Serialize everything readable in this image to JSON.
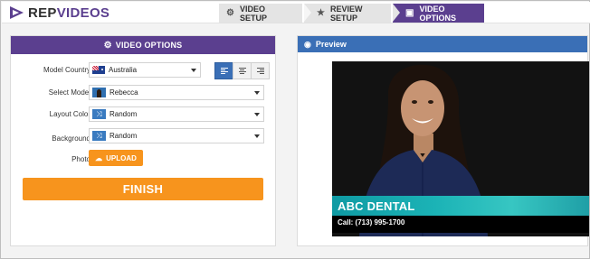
{
  "brand": {
    "name_part1": "REP",
    "name_part2": "VIDEOS",
    "accent": "#5b3f8f"
  },
  "steps": [
    {
      "label": "VIDEO SETUP",
      "icon": "gears-icon",
      "active": false
    },
    {
      "label": "REVIEW SETUP",
      "icon": "star-icon",
      "active": false
    },
    {
      "label": "VIDEO OPTIONS",
      "icon": "film-icon",
      "active": true
    }
  ],
  "options_panel": {
    "title": "VIDEO OPTIONS",
    "fields": {
      "model_country": {
        "label": "Model Country",
        "value": "Australia"
      },
      "select_model": {
        "label": "Select Model",
        "value": "Rebecca"
      },
      "layout_color": {
        "label": "Layout Color",
        "value": "Random"
      },
      "background": {
        "label": "Background",
        "value": "Random"
      },
      "photo": {
        "label": "Photo",
        "button": "UPLOAD"
      }
    },
    "alignment": [
      "left",
      "center",
      "right"
    ],
    "alignment_selected": "left",
    "finish_label": "FINISH"
  },
  "preview_panel": {
    "title": "Preview",
    "lower_third": {
      "name": "ABC DENTAL",
      "phone": "Call: (713) 995-1700"
    }
  },
  "colors": {
    "purple": "#5b3f8f",
    "blue": "#3a6fb6",
    "orange": "#f7941d",
    "teal": "#1bb3b6"
  }
}
